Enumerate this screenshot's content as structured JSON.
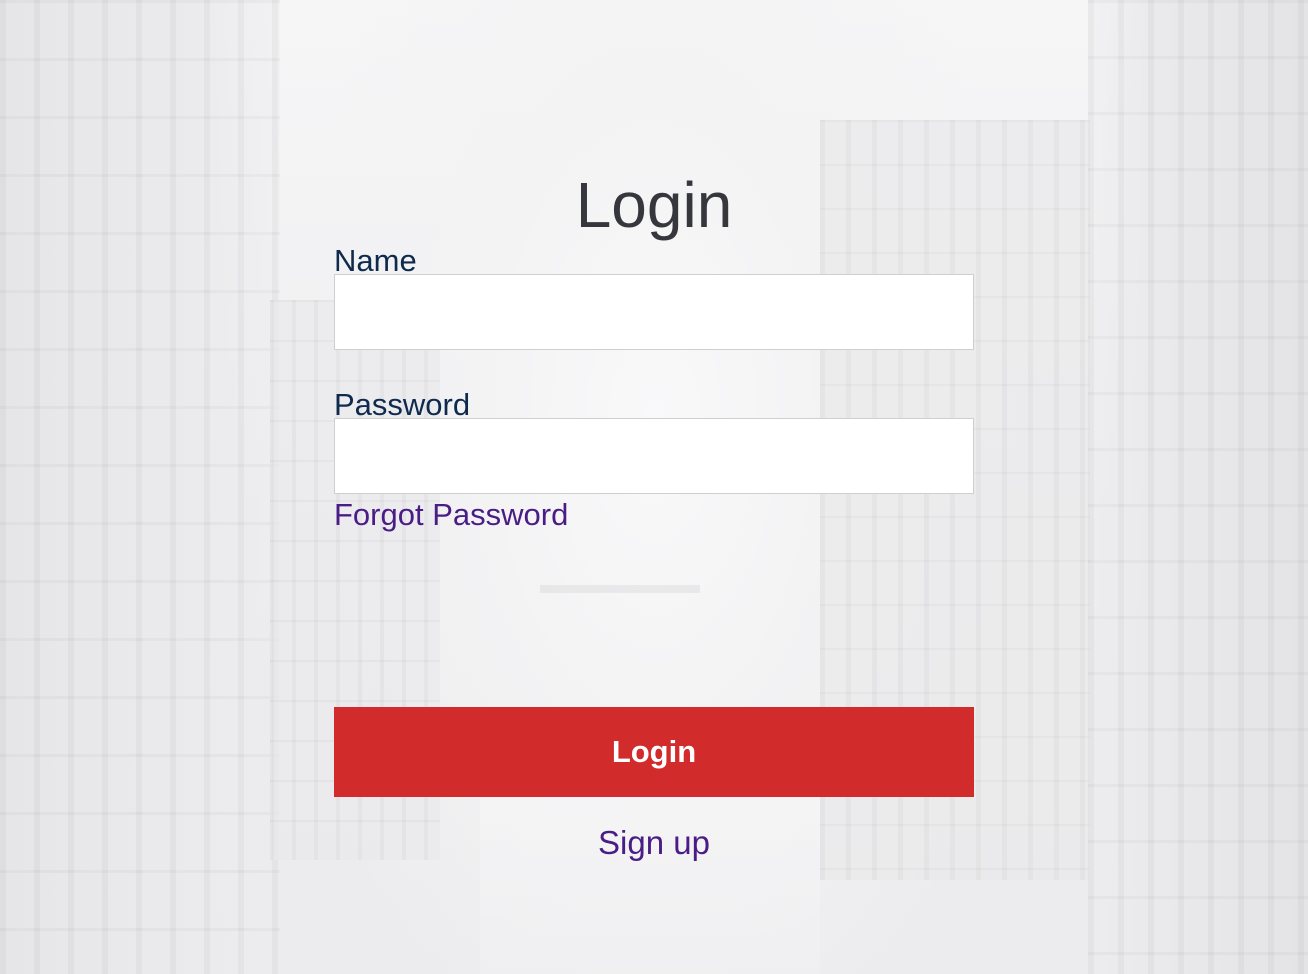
{
  "page": {
    "title": "Login"
  },
  "form": {
    "name_label": "Name",
    "name_value": "",
    "name_placeholder": "",
    "password_label": "Password",
    "password_value": "",
    "password_placeholder": "",
    "forgot_password_label": "Forgot Password",
    "login_button_label": "Login",
    "signup_label": "Sign up"
  },
  "colors": {
    "accent_button": "#d12b2b",
    "link": "#4a1d86",
    "label": "#0f2a4d",
    "title": "#36363d"
  }
}
